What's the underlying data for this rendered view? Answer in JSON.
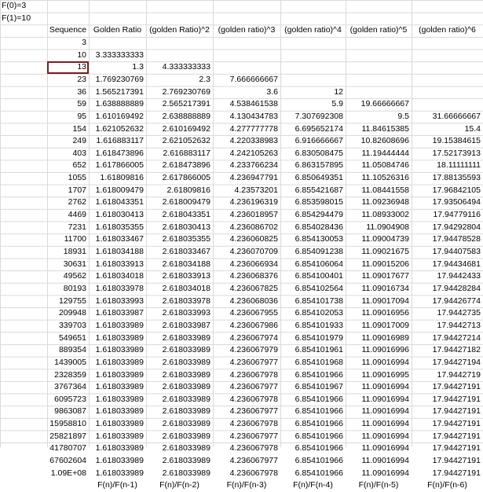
{
  "notes": [
    "F(0)=3",
    "F(1)=10"
  ],
  "headers": [
    "Sequence",
    "Golden Ratio",
    "(golden Ratio)^2",
    "(golden ratio)^3",
    "(golden ratio)^4",
    "(golden ratio)^5",
    "(golden ratio)^6"
  ],
  "rows": [
    [
      "3",
      "",
      "",
      "",
      "",
      "",
      ""
    ],
    [
      "10",
      "3.333333333",
      "",
      "",
      "",
      "",
      ""
    ],
    [
      "13",
      "1.3",
      "4.333333333",
      "",
      "",
      "",
      ""
    ],
    [
      "23",
      "1.769230769",
      "2.3",
      "7.666666667",
      "",
      "",
      ""
    ],
    [
      "36",
      "1.565217391",
      "2.769230769",
      "3.6",
      "12",
      "",
      ""
    ],
    [
      "59",
      "1.638888889",
      "2.565217391",
      "4.538461538",
      "5.9",
      "19.66666667",
      ""
    ],
    [
      "95",
      "1.610169492",
      "2.638888889",
      "4.130434783",
      "7.307692308",
      "9.5",
      "31.66666667"
    ],
    [
      "154",
      "1.621052632",
      "2.610169492",
      "4.277777778",
      "6.695652174",
      "11.84615385",
      "15.4"
    ],
    [
      "249",
      "1.616883117",
      "2.621052632",
      "4.220338983",
      "6.916666667",
      "10.82608696",
      "19.15384615"
    ],
    [
      "403",
      "1.618473896",
      "2.616883117",
      "4.242105263",
      "6.830508475",
      "11.19444444",
      "17.52173913"
    ],
    [
      "652",
      "1.617866005",
      "2.618473896",
      "4.233766234",
      "6.863157895",
      "11.05084746",
      "18.11111111"
    ],
    [
      "1055",
      "1.61809816",
      "2.617866005",
      "4.236947791",
      "6.850649351",
      "11.10526316",
      "17.88135593"
    ],
    [
      "1707",
      "1.618009479",
      "2.61809816",
      "4.23573201",
      "6.855421687",
      "11.08441558",
      "17.96842105"
    ],
    [
      "2762",
      "1.618043351",
      "2.618009479",
      "4.236196319",
      "6.853598015",
      "11.09236948",
      "17.93506494"
    ],
    [
      "4469",
      "1.618030413",
      "2.618043351",
      "4.236018957",
      "6.854294479",
      "11.08933002",
      "17.94779116"
    ],
    [
      "7231",
      "1.618035355",
      "2.618030413",
      "4.236086702",
      "6.854028436",
      "11.0904908",
      "17.94292804"
    ],
    [
      "11700",
      "1.618033467",
      "2.618035355",
      "4.236060825",
      "6.854130053",
      "11.09004739",
      "17.94478528"
    ],
    [
      "18931",
      "1.618034188",
      "2.618033467",
      "4.236070709",
      "6.854091238",
      "11.09021675",
      "17.94407583"
    ],
    [
      "30631",
      "1.618033913",
      "2.618034188",
      "4.236066934",
      "6.854106064",
      "11.09015206",
      "17.94434681"
    ],
    [
      "49562",
      "1.618034018",
      "2.618033913",
      "4.236068376",
      "6.854100401",
      "11.09017677",
      "17.9442433"
    ],
    [
      "80193",
      "1.618033978",
      "2.618034018",
      "4.236067825",
      "6.854102564",
      "11.09016734",
      "17.94428284"
    ],
    [
      "129755",
      "1.618033993",
      "2.618033978",
      "4.236068036",
      "6.854101738",
      "11.09017094",
      "17.94426774"
    ],
    [
      "209948",
      "1.618033987",
      "2.618033993",
      "4.236067955",
      "6.854102053",
      "11.09016956",
      "17.9442735"
    ],
    [
      "339703",
      "1.618033989",
      "2.618033987",
      "4.236067986",
      "6.854101933",
      "11.09017009",
      "17.9442713"
    ],
    [
      "549651",
      "1.618033989",
      "2.618033989",
      "4.236067974",
      "6.854101979",
      "11.09016989",
      "17.94427214"
    ],
    [
      "889354",
      "1.618033989",
      "2.618033989",
      "4.236067979",
      "6.854101961",
      "11.09016996",
      "17.94427182"
    ],
    [
      "1439005",
      "1.618033989",
      "2.618033989",
      "4.236067977",
      "6.854101968",
      "11.09016994",
      "17.94427194"
    ],
    [
      "2328359",
      "1.618033989",
      "2.618033989",
      "4.236067978",
      "6.854101966",
      "11.09016995",
      "17.9442719"
    ],
    [
      "3767364",
      "1.618033989",
      "2.618033989",
      "4.236067977",
      "6.854101967",
      "11.09016994",
      "17.94427191"
    ],
    [
      "6095723",
      "1.618033989",
      "2.618033989",
      "4.236067978",
      "6.854101966",
      "11.09016994",
      "17.94427191"
    ],
    [
      "9863087",
      "1.618033989",
      "2.618033989",
      "4.236067977",
      "6.854101966",
      "11.09016994",
      "17.94427191"
    ],
    [
      "15958810",
      "1.618033989",
      "2.618033989",
      "4.236067978",
      "6.854101966",
      "11.09016994",
      "17.94427191"
    ],
    [
      "25821897",
      "1.618033989",
      "2.618033989",
      "4.236067977",
      "6.854101966",
      "11.09016994",
      "17.94427191"
    ],
    [
      "41780707",
      "1.618033989",
      "2.618033989",
      "4.236067978",
      "6.854101966",
      "11.09016994",
      "17.94427191"
    ],
    [
      "67602604",
      "1.618033989",
      "2.618033989",
      "4.236067977",
      "6.854101966",
      "11.09016994",
      "17.94427191"
    ],
    [
      "1.09E+08",
      "1.618033989",
      "2.618033989",
      "4.236067978",
      "6.854101966",
      "11.09016994",
      "17.94427191"
    ]
  ],
  "footers": [
    "",
    "F(n)/F(n-1)",
    "F(n)/F(n-2)",
    "F(n)/F(n-3)",
    "F(n)/F(n-4)",
    "F(n)/F(n-5)",
    "F(n)/F(n-6)"
  ],
  "selected_cell_value": "13",
  "colors": {
    "gridline": "#d9d9d9",
    "selection": "#7a1f1f"
  }
}
